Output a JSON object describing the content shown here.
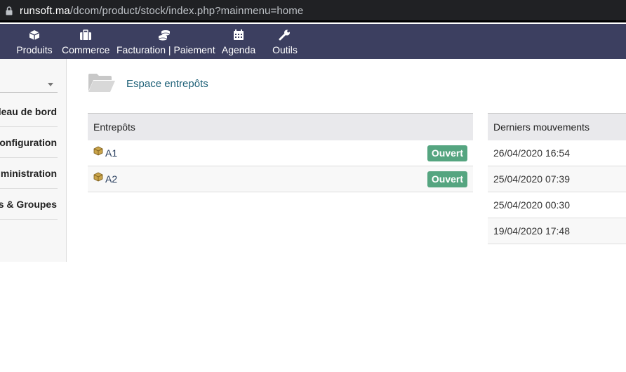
{
  "browser": {
    "url_host": "runsoft.ma",
    "url_path": "/dcom/product/stock/index.php?mainmenu=home"
  },
  "topmenu": {
    "items": [
      {
        "label": "Produits",
        "icon": "cube-icon"
      },
      {
        "label": "Commerce",
        "icon": "briefcase-icon"
      },
      {
        "label": "Facturation | Paiement",
        "icon": "coins-icon"
      },
      {
        "label": "Agenda",
        "icon": "calendar-icon"
      },
      {
        "label": "Outils",
        "icon": "wrench-icon"
      }
    ],
    "background": "#3c3f60"
  },
  "sidebar": {
    "items": [
      {
        "label": "Tableau de bord"
      },
      {
        "label": "Configuration"
      },
      {
        "label": "Administration"
      },
      {
        "label": "Utilisateurs & Groupes"
      }
    ]
  },
  "page": {
    "title": "Espace entrepôts"
  },
  "warehouses": {
    "header": "Entrepôts",
    "rows": [
      {
        "name": "A1",
        "status": "Ouvert"
      },
      {
        "name": "A2",
        "status": "Ouvert"
      }
    ],
    "status_color": "#55a580"
  },
  "movements": {
    "header": "Derniers mouvements",
    "rows": [
      {
        "date": "26/04/2020 16:54"
      },
      {
        "date": "25/04/2020 07:39"
      },
      {
        "date": "25/04/2020 00:30"
      },
      {
        "date": "19/04/2020 17:48"
      }
    ]
  }
}
